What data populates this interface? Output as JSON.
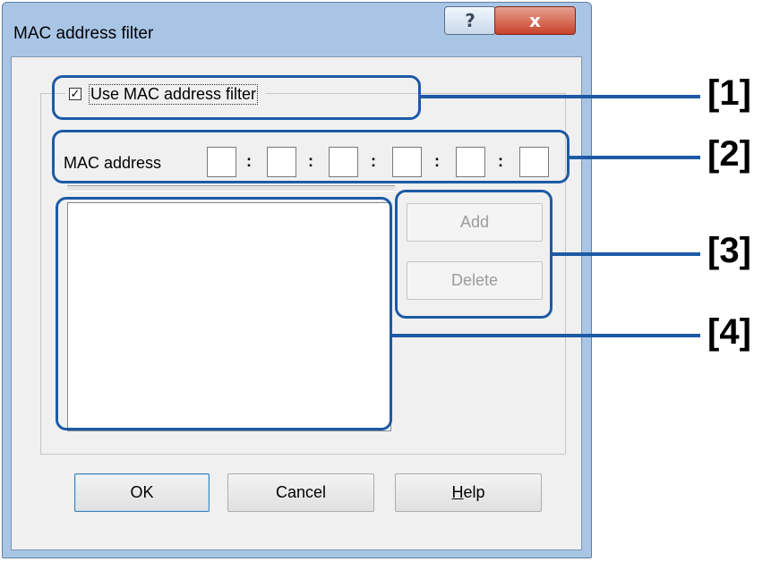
{
  "window": {
    "title": "MAC address filter",
    "help_glyph": "?",
    "close_glyph": "x"
  },
  "group": {
    "checkbox_checked": true,
    "checkbox_glyph": "✓",
    "label": "Use MAC address filter"
  },
  "mac": {
    "label": "MAC address",
    "octets": [
      "",
      "",
      "",
      "",
      "",
      ""
    ],
    "separator": ":"
  },
  "buttons": {
    "add": "Add",
    "delete": "Delete",
    "ok": "OK",
    "cancel": "Cancel",
    "help_mnemonic": "H",
    "help_rest": "elp"
  },
  "annotations": [
    "[1]",
    "[2]",
    "[3]",
    "[4]"
  ],
  "colors": {
    "callout": "#1d5aa6",
    "close_button": "#c7422a",
    "frame": "#a9c5e6"
  }
}
